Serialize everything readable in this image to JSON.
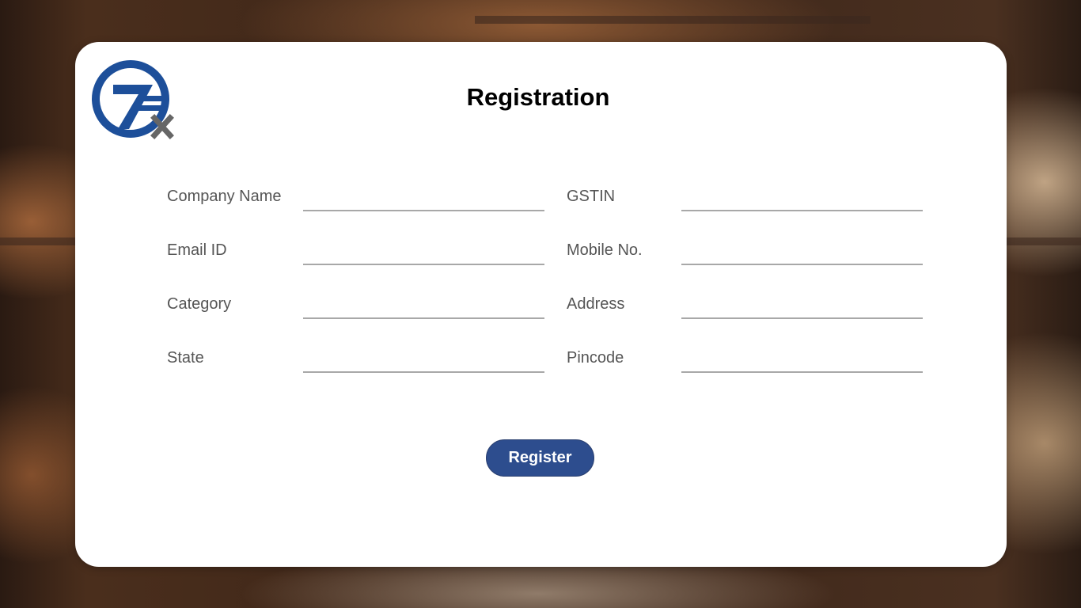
{
  "header": {
    "title": "Registration",
    "logo_icon": "tzex-logo-icon"
  },
  "form": {
    "fields": [
      {
        "label": "Company Name",
        "value": "",
        "column": "left"
      },
      {
        "label": "GSTIN",
        "value": "",
        "column": "right"
      },
      {
        "label": "Email ID",
        "value": "",
        "column": "left"
      },
      {
        "label": "Mobile No.",
        "value": "",
        "column": "right"
      },
      {
        "label": "Category",
        "value": "",
        "column": "left"
      },
      {
        "label": "Address",
        "value": "",
        "column": "right"
      },
      {
        "label": "State",
        "value": "",
        "column": "left"
      },
      {
        "label": "Pincode",
        "value": "",
        "column": "right"
      }
    ],
    "submit_label": "Register"
  },
  "colors": {
    "button": "#2d4d8e",
    "logo_blue": "#1d4f9a",
    "logo_gray": "#666666",
    "label_text": "#555555",
    "underline": "#a8a8a8"
  }
}
